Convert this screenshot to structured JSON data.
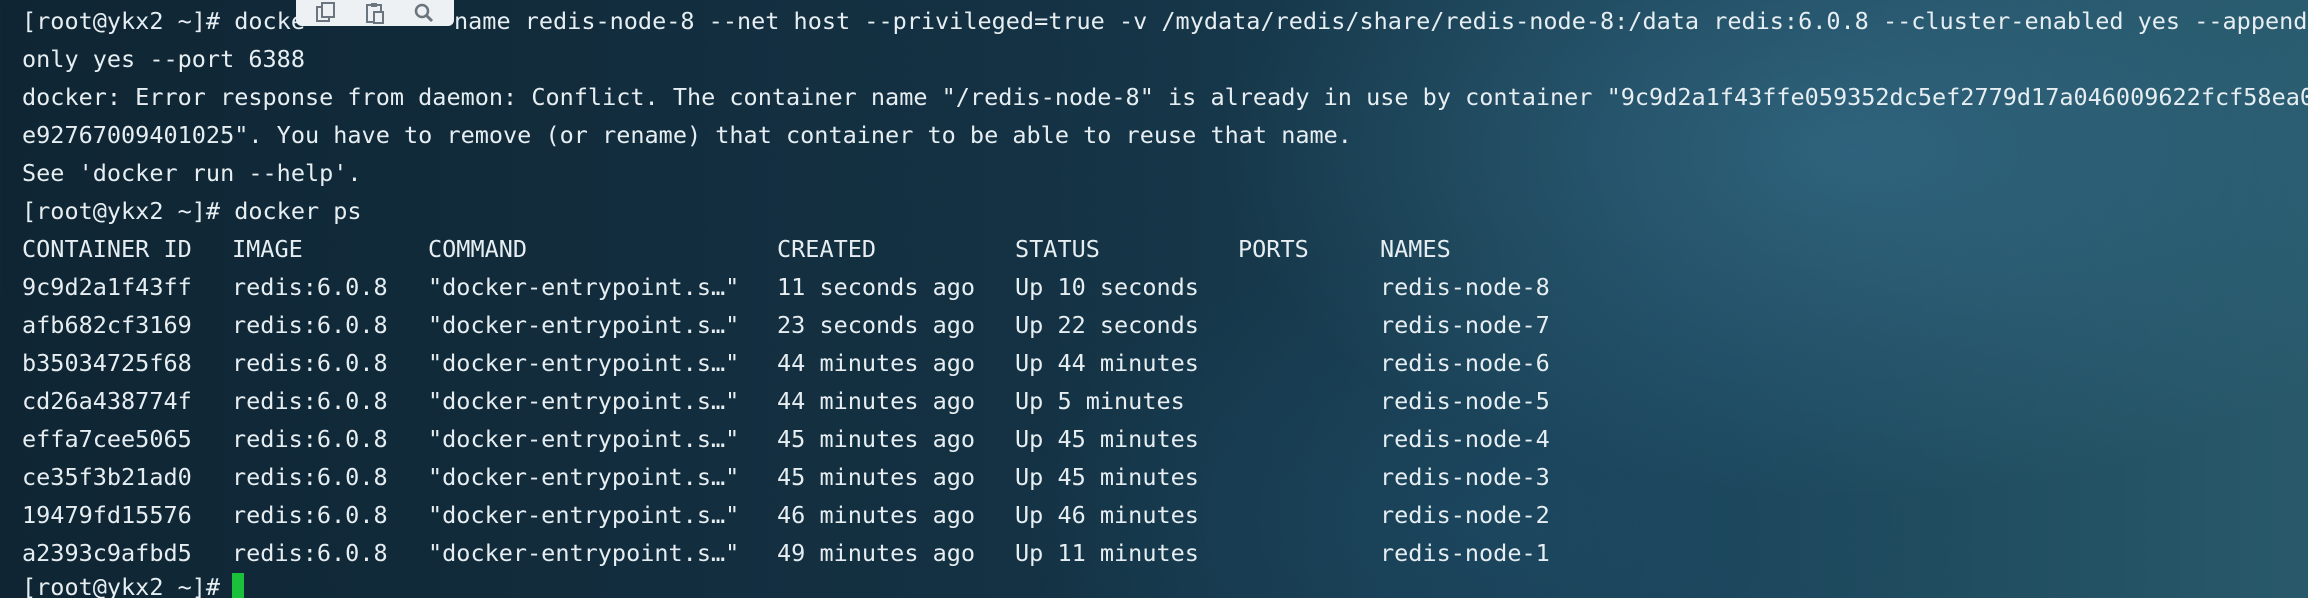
{
  "terminal": {
    "lines": [
      "[root@ykx2 ~]# docke",
      "name redis-node-8 --net host --privileged=true -v /mydata/redis/share/redis-node-8:/data redis:6.0.8 --cluster-enabled yes --append",
      "only yes --port 6388",
      "docker: Error response from daemon: Conflict. The container name \"/redis-node-8\" is already in use by container \"9c9d2a1f43ffe059352dc5ef2779d17a046009622fcf58ea0",
      "e92767009401025\". You have to remove (or rename) that container to be able to reuse that name.",
      "See 'docker run --help'.",
      "[root@ykx2 ~]# docker ps",
      "[root@ykx2 ~]#"
    ],
    "table": {
      "headers": [
        "CONTAINER ID",
        "IMAGE",
        "COMMAND",
        "CREATED",
        "STATUS",
        "PORTS",
        "NAMES"
      ],
      "rows": [
        [
          "9c9d2a1f43ff",
          "redis:6.0.8",
          "\"docker-entrypoint.s…\"",
          "11 seconds ago",
          "Up 10 seconds",
          "",
          "redis-node-8"
        ],
        [
          "afb682cf3169",
          "redis:6.0.8",
          "\"docker-entrypoint.s…\"",
          "23 seconds ago",
          "Up 22 seconds",
          "",
          "redis-node-7"
        ],
        [
          "b35034725f68",
          "redis:6.0.8",
          "\"docker-entrypoint.s…\"",
          "44 minutes ago",
          "Up 44 minutes",
          "",
          "redis-node-6"
        ],
        [
          "cd26a438774f",
          "redis:6.0.8",
          "\"docker-entrypoint.s…\"",
          "44 minutes ago",
          "Up 5 minutes",
          "",
          "redis-node-5"
        ],
        [
          "effa7cee5065",
          "redis:6.0.8",
          "\"docker-entrypoint.s…\"",
          "45 minutes ago",
          "Up 45 minutes",
          "",
          "redis-node-4"
        ],
        [
          "ce35f3b21ad0",
          "redis:6.0.8",
          "\"docker-entrypoint.s…\"",
          "45 minutes ago",
          "Up 45 minutes",
          "",
          "redis-node-3"
        ],
        [
          "19479fd15576",
          "redis:6.0.8",
          "\"docker-entrypoint.s…\"",
          "46 minutes ago",
          "Up 46 minutes",
          "",
          "redis-node-2"
        ],
        [
          "a2393c9afbd5",
          "redis:6.0.8",
          "\"docker-entrypoint.s…\"",
          "49 minutes ago",
          "Up 11 minutes",
          "",
          "redis-node-1"
        ]
      ]
    },
    "colors": {
      "text": "#e6eef2",
      "cursor": "#19c23a"
    }
  },
  "toolbar": {
    "icons": [
      "copy-icon",
      "paste-icon",
      "search-icon"
    ]
  }
}
